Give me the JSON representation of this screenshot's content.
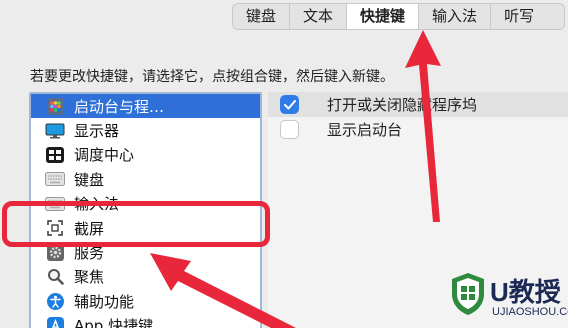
{
  "tabs": [
    {
      "label": "键盘",
      "active": false
    },
    {
      "label": "文本",
      "active": false
    },
    {
      "label": "快捷键",
      "active": true
    },
    {
      "label": "输入法",
      "active": false
    },
    {
      "label": "听写",
      "active": false
    }
  ],
  "instruction": "若要更改快捷键，请选择它，点按组合键，然后键入新键。",
  "left_list": [
    {
      "label": "启动台与程…",
      "icon": "launchpad-icon",
      "selected": true
    },
    {
      "label": "显示器",
      "icon": "display-icon",
      "selected": false
    },
    {
      "label": "调度中心",
      "icon": "mission-control-icon",
      "selected": false
    },
    {
      "label": "键盘",
      "icon": "keyboard-icon",
      "selected": false
    },
    {
      "label": "输入法",
      "icon": "input-method-icon",
      "selected": false
    },
    {
      "label": "截屏",
      "icon": "screenshot-icon",
      "selected": false
    },
    {
      "label": "服务",
      "icon": "services-gear-icon",
      "selected": false
    },
    {
      "label": "聚焦",
      "icon": "spotlight-search-icon",
      "selected": false
    },
    {
      "label": "辅助功能",
      "icon": "accessibility-icon",
      "selected": false
    },
    {
      "label": "App 快捷键",
      "icon": "app-shortcuts-icon",
      "selected": false
    }
  ],
  "right_list": [
    {
      "label": "打开或关闭隐藏程序坞",
      "checked": true
    },
    {
      "label": "显示启动台",
      "checked": false
    }
  ],
  "watermark": {
    "brand": "U教授",
    "site": "UJIAOSHOU.COM"
  },
  "colors": {
    "selection": "#2f6fd8",
    "checkbox_on": "#2f7be8",
    "annotation": "#e8283a",
    "logo_green": "#2e8b3d"
  }
}
